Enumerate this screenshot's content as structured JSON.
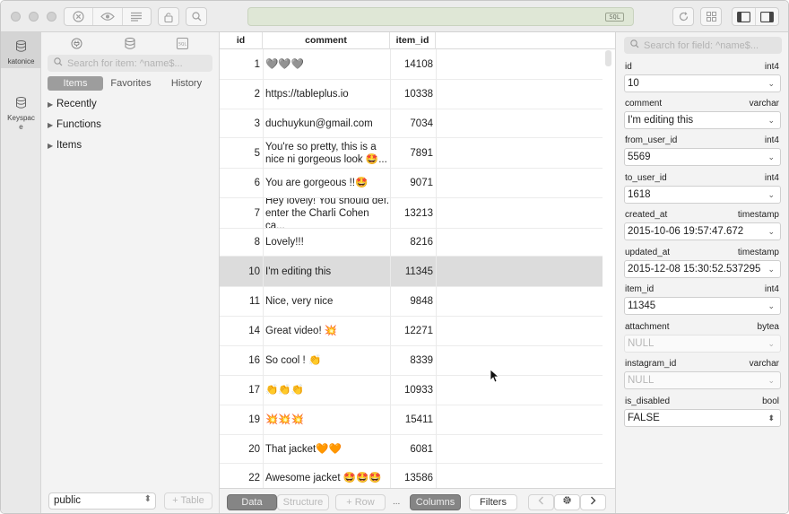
{
  "toolbar": {
    "sql_badge": "SQL",
    "icons": [
      "close-circle-icon",
      "eye-icon",
      "list-icon",
      "lock-icon",
      "search-icon",
      "refresh-icon",
      "grid-icon",
      "left-panel-icon",
      "right-panel-icon"
    ]
  },
  "rail": {
    "items": [
      {
        "label": "katonice",
        "icon": "database-icon",
        "active": true
      },
      {
        "label": "Keyspace",
        "icon": "database-icon",
        "active": false
      }
    ]
  },
  "sidebar": {
    "top_icons": [
      "plug-icon",
      "database-icon",
      "sql-file-icon"
    ],
    "search_placeholder": "Search for item: ^name$...",
    "tabs": [
      {
        "label": "Items",
        "active": true
      },
      {
        "label": "Favorites",
        "active": false
      },
      {
        "label": "History",
        "active": false
      }
    ],
    "tree": [
      {
        "label": "Recently"
      },
      {
        "label": "Functions"
      },
      {
        "label": "Items"
      }
    ],
    "schema_select": "public",
    "add_table_label": "+ Table"
  },
  "grid": {
    "columns": [
      "id",
      "comment",
      "item_id"
    ],
    "rows": [
      {
        "id": "1",
        "comment": "🩶🩶🩶",
        "item_id": "14108"
      },
      {
        "id": "2",
        "comment": "https://tableplus.io",
        "item_id": "10338"
      },
      {
        "id": "3",
        "comment": "duchuykun@gmail.com",
        "item_id": "7034"
      },
      {
        "id": "5",
        "comment": "You're so pretty, this is a\nnice ni gorgeous look 🤩...",
        "item_id": "7891"
      },
      {
        "id": "6",
        "comment": "You are gorgeous !!🤩",
        "item_id": "9071"
      },
      {
        "id": "7",
        "comment": "Hey lovely! You should def.\nenter the Charli Cohen ca...",
        "item_id": "13213"
      },
      {
        "id": "8",
        "comment": "Lovely!!!",
        "item_id": "8216"
      },
      {
        "id": "10",
        "comment": "I'm editing this",
        "item_id": "11345",
        "selected": true
      },
      {
        "id": "11",
        "comment": "Nice, very nice",
        "item_id": "9848"
      },
      {
        "id": "14",
        "comment": "Great video! 💥",
        "item_id": "12271"
      },
      {
        "id": "16",
        "comment": "So cool ! 👏",
        "item_id": "8339"
      },
      {
        "id": "17",
        "comment": "👏👏👏",
        "item_id": "10933"
      },
      {
        "id": "19",
        "comment": "💥💥💥",
        "item_id": "15411"
      },
      {
        "id": "20",
        "comment": "That jacket🧡🧡",
        "item_id": "6081"
      },
      {
        "id": "22",
        "comment": "Awesome jacket 🤩🤩🤩",
        "item_id": "13586"
      }
    ]
  },
  "bottom_bar": {
    "data_label": "Data",
    "structure_label": "Structure",
    "row_label": "+ Row",
    "more_label": "...",
    "columns_label": "Columns",
    "filters_label": "Filters",
    "prev_icon": "chevron-left-icon",
    "settings_icon": "gear-icon",
    "next_icon": "chevron-right-icon"
  },
  "panel": {
    "search_placeholder": "Search for field: ^name$...",
    "fields": [
      {
        "name": "id",
        "type": "int4",
        "value": "10",
        "null": false
      },
      {
        "name": "comment",
        "type": "varchar",
        "value": "I'm editing this",
        "null": false
      },
      {
        "name": "from_user_id",
        "type": "int4",
        "value": "5569",
        "null": false
      },
      {
        "name": "to_user_id",
        "type": "int4",
        "value": "1618",
        "null": false
      },
      {
        "name": "created_at",
        "type": "timestamp",
        "value": "2015-10-06 19:57:47.672",
        "null": false
      },
      {
        "name": "updated_at",
        "type": "timestamp",
        "value": "2015-12-08 15:30:52.537295",
        "null": false
      },
      {
        "name": "item_id",
        "type": "int4",
        "value": "11345",
        "null": false
      },
      {
        "name": "attachment",
        "type": "bytea",
        "value": "NULL",
        "null": true
      },
      {
        "name": "instagram_id",
        "type": "varchar",
        "value": "NULL",
        "null": true
      },
      {
        "name": "is_disabled",
        "type": "bool",
        "value": "FALSE",
        "null": false
      }
    ]
  }
}
